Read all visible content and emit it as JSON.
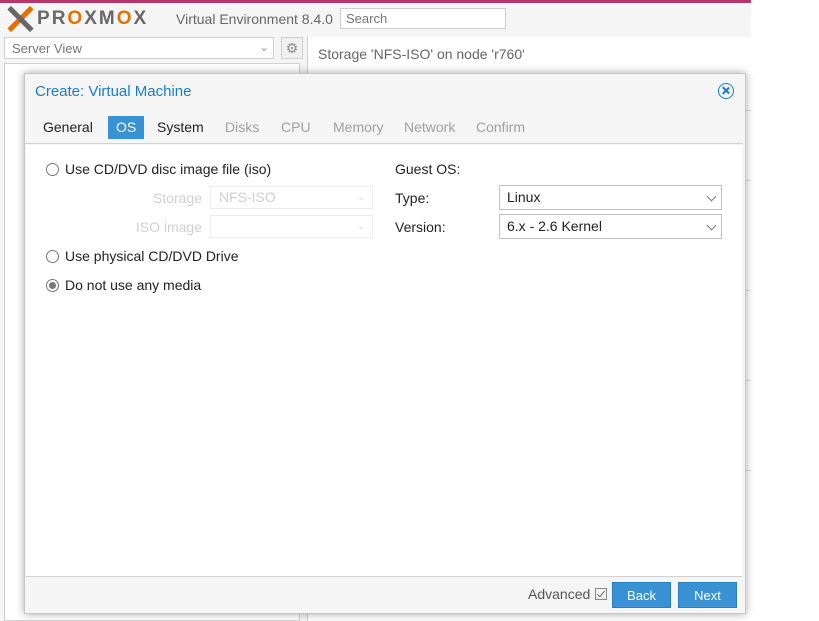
{
  "header": {
    "logo_text": "PROXMOX",
    "product": "Virtual Environment 8.4.0",
    "search_placeholder": "Search"
  },
  "sidebar": {
    "view": "Server View"
  },
  "content": {
    "title": "Storage 'NFS-ISO' on node 'r760'"
  },
  "dialog": {
    "title": "Create: Virtual Machine",
    "tabs": [
      {
        "label": "General",
        "state": "normal"
      },
      {
        "label": "OS",
        "state": "active"
      },
      {
        "label": "System",
        "state": "normal"
      },
      {
        "label": "Disks",
        "state": "disabled"
      },
      {
        "label": "CPU",
        "state": "disabled"
      },
      {
        "label": "Memory",
        "state": "disabled"
      },
      {
        "label": "Network",
        "state": "disabled"
      },
      {
        "label": "Confirm",
        "state": "disabled"
      }
    ],
    "media": {
      "iso_option": "Use CD/DVD disc image file (iso)",
      "storage_label": "Storage",
      "storage_value": "NFS-ISO",
      "iso_image_label": "ISO image",
      "iso_image_value": "",
      "physical_option": "Use physical CD/DVD Drive",
      "none_option": "Do not use any media",
      "selected": "none"
    },
    "guest_os": {
      "heading": "Guest OS:",
      "type_label": "Type:",
      "type_value": "Linux",
      "version_label": "Version:",
      "version_value": "6.x - 2.6 Kernel"
    },
    "footer": {
      "advanced_label": "Advanced",
      "advanced_checked": true,
      "back_label": "Back",
      "next_label": "Next"
    }
  },
  "colors": {
    "accent": "#3892d4",
    "title_blue": "#157fcc",
    "brand_orange": "#e57000",
    "brand_pink": "#b5376b"
  }
}
